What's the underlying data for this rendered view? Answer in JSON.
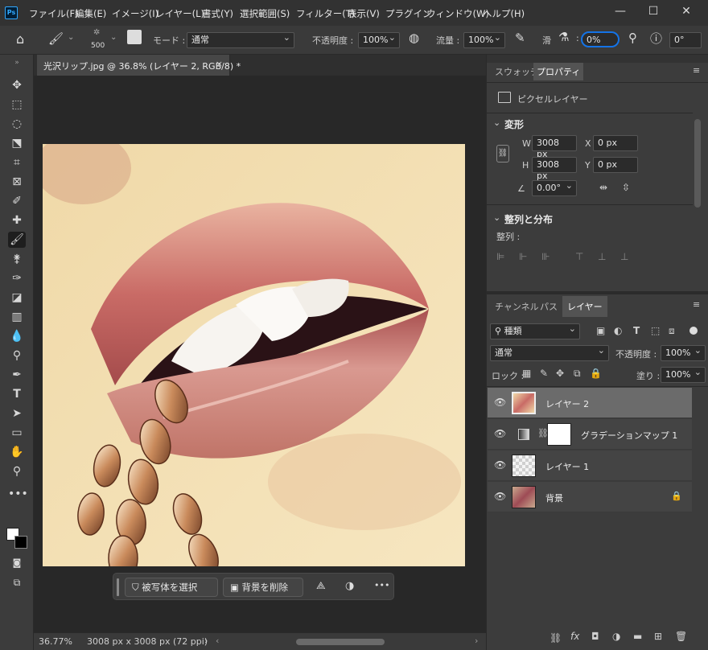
{
  "app": {
    "logo": "Ps"
  },
  "menu": [
    "ファイル(F)",
    "編集(E)",
    "イメージ(I)",
    "レイヤー(L)",
    "書式(Y)",
    "選択範囲(S)",
    "フィルター(T)",
    "表示(V)",
    "プラグイン",
    "ウィンドウ(W)",
    "ヘルプ(H)"
  ],
  "window_controls": {
    "minimize": "—",
    "maximize": "☐",
    "close": "✕"
  },
  "options": {
    "brush_size": "500",
    "mode_label": "モード :",
    "mode_value": "通常",
    "opacity_label": "不透明度 :",
    "opacity_value": "100%",
    "flow_label": "流量 :",
    "flow_value": "100%",
    "smoothing_label": "滑",
    "smoothing_value": "0%",
    "angle_value": "0°"
  },
  "document": {
    "tab_title": "光沢リップ.jpg @ 36.8% (レイヤー 2, RGB/8) *",
    "close": "×"
  },
  "context_bar": {
    "select_subject": "被写体を選択",
    "remove_bg": "背景を削除",
    "more": "•••"
  },
  "status": {
    "zoom": "36.77%",
    "doc_info": "3008 px x 3008 px (72 ppi)",
    "arrow": "›"
  },
  "panels": {
    "top_tabs": [
      "スウォッチ",
      "プロパティ"
    ],
    "properties": {
      "kind": "ピクセルレイヤー",
      "transform_title": "変形",
      "w_label": "W",
      "w_value": "3008 px",
      "h_label": "H",
      "h_value": "3008 px",
      "x_label": "X",
      "x_value": "0 px",
      "y_label": "Y",
      "y_value": "0 px",
      "angle_value": "0.00°",
      "align_title": "整列と分布",
      "align_label": "整列 :"
    },
    "layer_tabs": [
      "チャンネル",
      "パス",
      "レイヤー"
    ],
    "layers_panel": {
      "filter_kind": "種類",
      "blend_mode": "通常",
      "opacity_label": "不透明度 :",
      "opacity_value": "100%",
      "lock_label": "ロック :",
      "fill_label": "塗り :",
      "fill_value": "100%",
      "layers": [
        {
          "name": "レイヤー 2"
        },
        {
          "name": "グラデーションマップ 1"
        },
        {
          "name": "レイヤー 1"
        },
        {
          "name": "背景"
        }
      ]
    }
  }
}
